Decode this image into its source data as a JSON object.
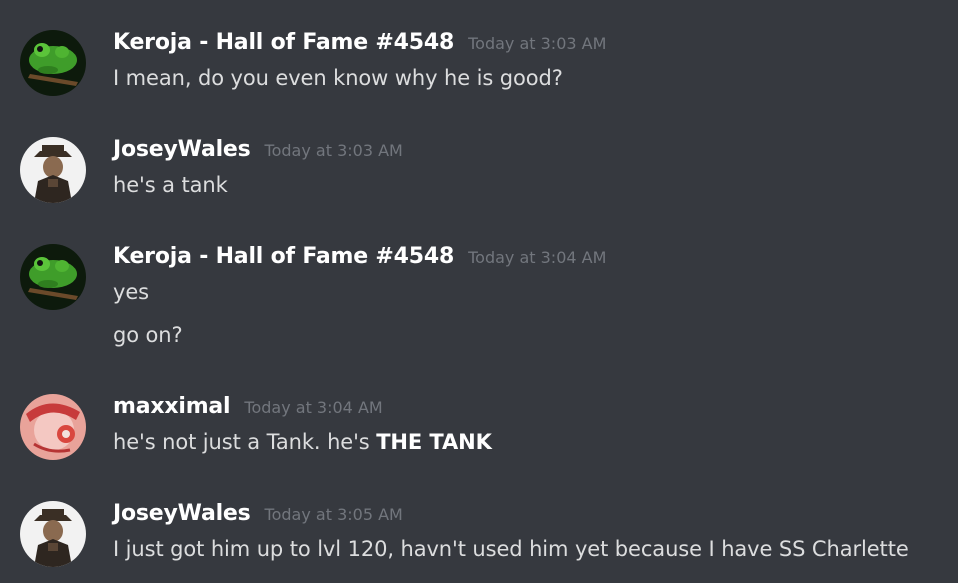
{
  "messages": [
    {
      "username": "Keroja - Hall of Fame #4548",
      "timestamp": "Today at 3:03 AM",
      "avatar_icon": "frog-avatar",
      "lines": [
        "I mean, do you even know why he is good?"
      ]
    },
    {
      "username": "JoseyWales",
      "timestamp": "Today at 3:03 AM",
      "avatar_icon": "cowboy-avatar",
      "lines": [
        "he's a tank"
      ]
    },
    {
      "username": "Keroja - Hall of Fame #4548",
      "timestamp": "Today at 3:04 AM",
      "avatar_icon": "frog-avatar",
      "lines": [
        "yes",
        "go on?"
      ]
    },
    {
      "username": "maxximal",
      "timestamp": "Today at 3:04 AM",
      "avatar_icon": "anime-avatar",
      "line_prefix": "he's not just a Tank. he's ",
      "line_bold": "THE TANK"
    },
    {
      "username": "JoseyWales",
      "timestamp": "Today at 3:05 AM",
      "avatar_icon": "cowboy-avatar",
      "lines": [
        "I just got him up to lvl 120, havn't used him yet because I have SS Charlette"
      ]
    }
  ],
  "colors": {
    "background": "#36393f",
    "username": "#ffffff",
    "timestamp": "#72767d",
    "text": "#dcddde"
  }
}
